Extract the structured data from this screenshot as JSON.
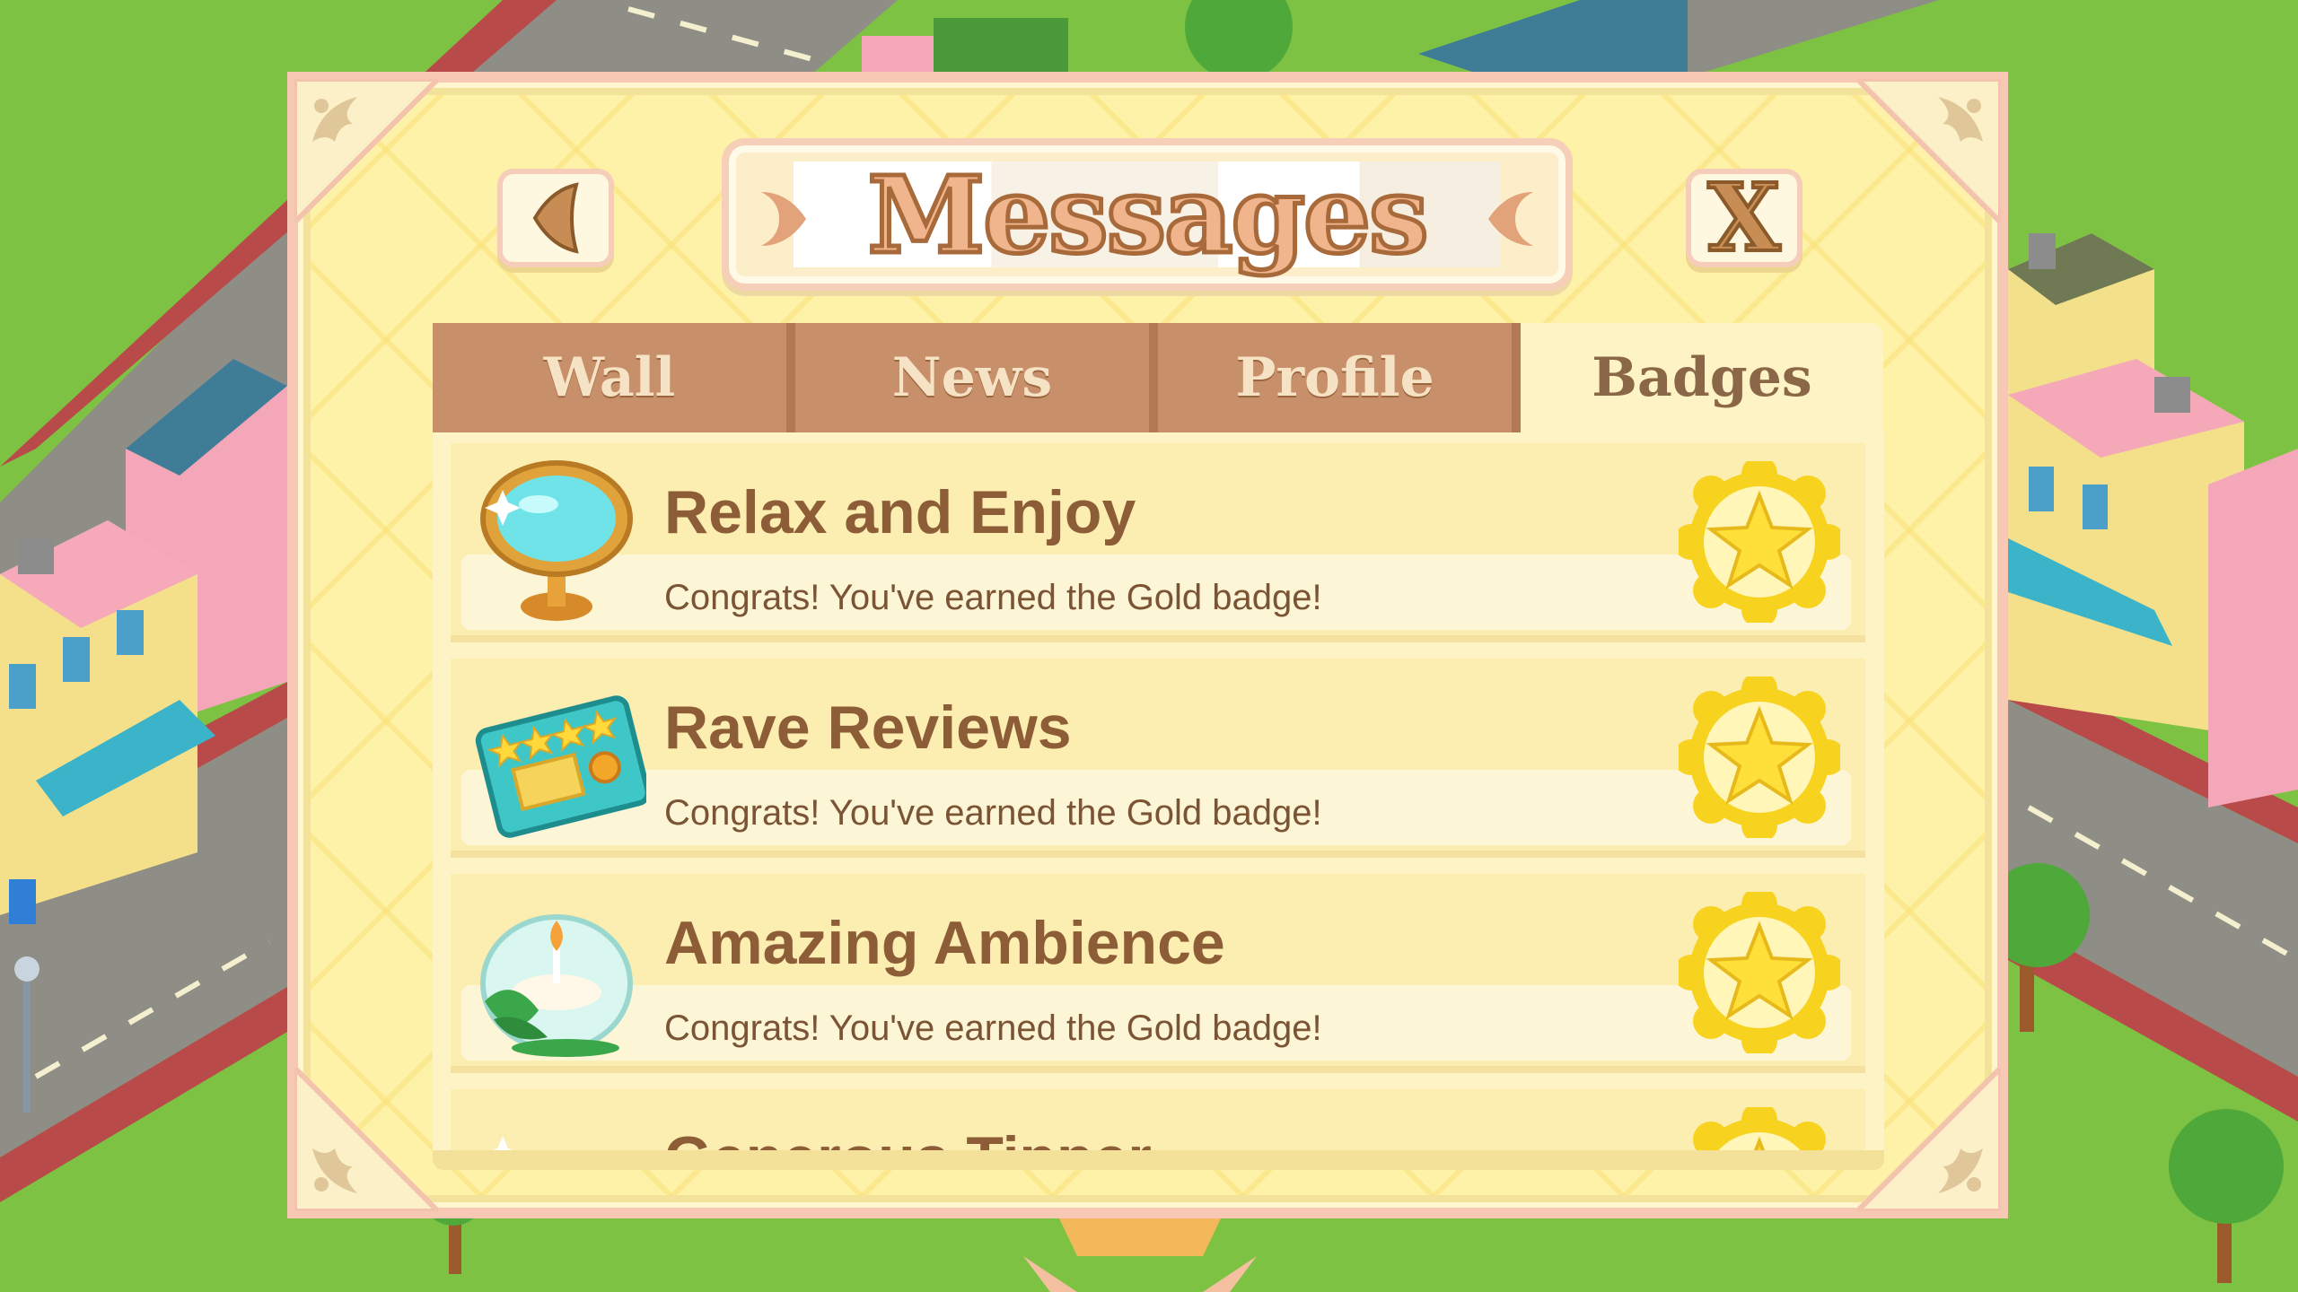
{
  "header": {
    "title": "Messages",
    "back_icon": "back-arrow-icon",
    "close_label": "X"
  },
  "tabs": [
    {
      "label": "Wall",
      "active": false
    },
    {
      "label": "News",
      "active": false
    },
    {
      "label": "Profile",
      "active": false
    },
    {
      "label": "Badges",
      "active": true
    }
  ],
  "badges": [
    {
      "title": "Relax and Enjoy",
      "message": "Congrats! You've earned the Gold badge!",
      "icon": "mirror-icon",
      "badge": "gold-star-badge-icon"
    },
    {
      "title": "Rave Reviews",
      "message": "Congrats! You've earned the Gold badge!",
      "icon": "review-card-icon",
      "badge": "gold-star-badge-icon"
    },
    {
      "title": "Amazing Ambience",
      "message": "Congrats! You've earned the Gold badge!",
      "icon": "candle-bowl-icon",
      "badge": "gold-star-badge-icon"
    },
    {
      "title": "Generous Tipper",
      "message": "",
      "icon": "tip-icon",
      "badge": "gold-star-badge-icon"
    }
  ],
  "colors": {
    "modal_bg": "#fdf2a8",
    "modal_border": "#f7c8b4",
    "tab_inactive": "#c8906a",
    "tab_active": "#fdf3c4",
    "title_text": "#8c5d37",
    "badge_gold": "#f7d21f",
    "grass": "#7dc243"
  }
}
